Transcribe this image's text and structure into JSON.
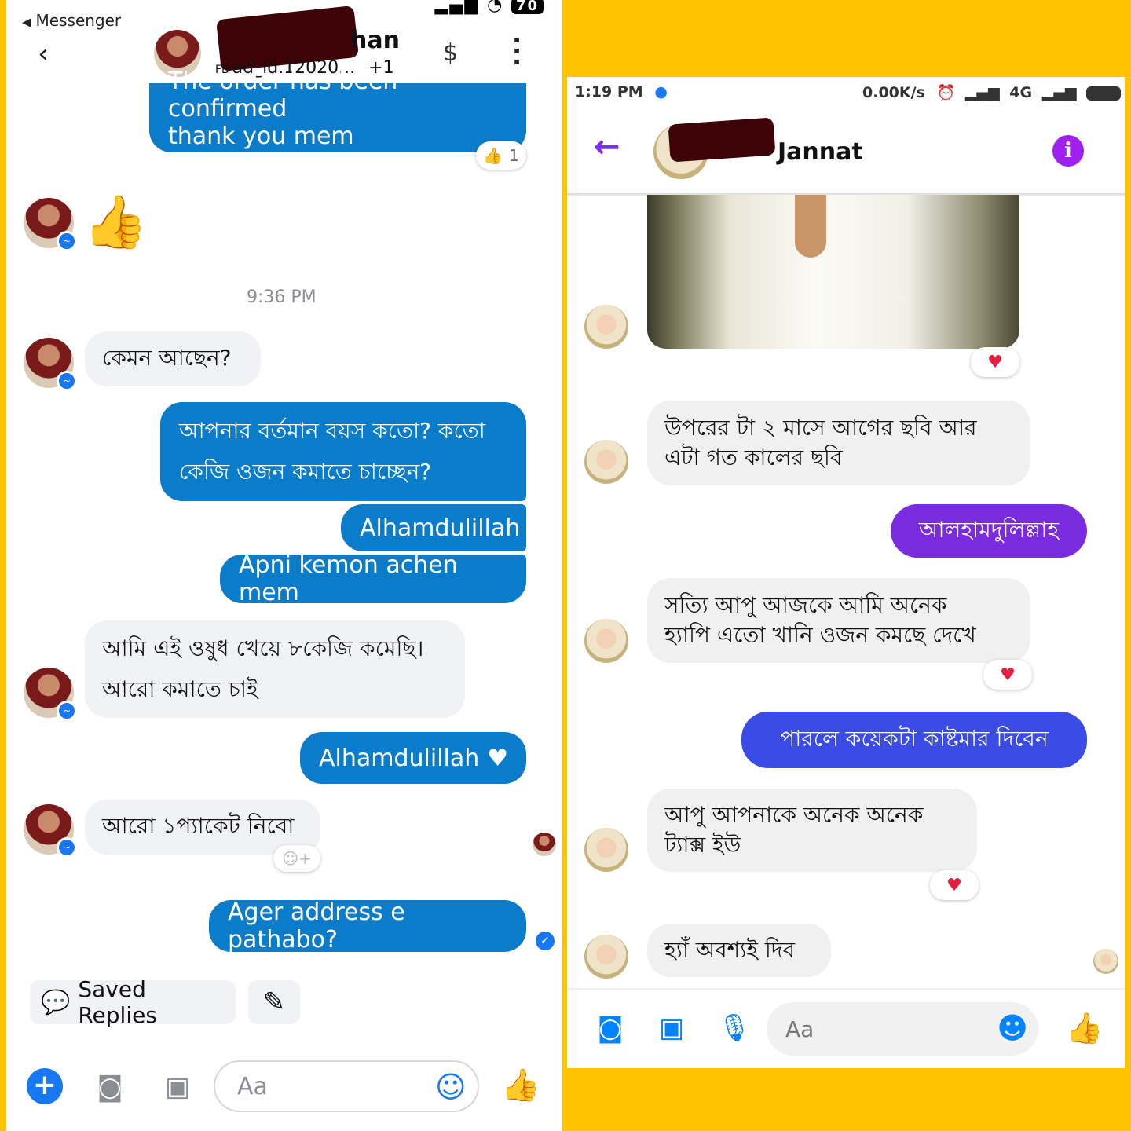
{
  "left": {
    "back_app": "Messenger",
    "battery": "70",
    "header": {
      "name_suffix": "han",
      "subtitle_tag": "FB",
      "subtitle": "ad_id.12020...",
      "subtitle_extra": "+1",
      "dollar": "$"
    },
    "messages": {
      "confirmed_top": "The order has been confirmed",
      "confirmed_bottom": "thank you mem",
      "reaction_count": "1",
      "time": "9:36 PM",
      "in1": "কেমন আছেন?",
      "out1_line1": "আপনার বর্তমান বয়স কতো? কতো",
      "out1_line2": "কেজি ওজন কমাতে চাচ্ছেন?",
      "out2": "Alhamdulillah",
      "out3": "Apni kemon achen mem",
      "in2_line1": "আমি এই ওষুধ খেয়ে ৮কেজি কমেছি।",
      "in2_line2": "আরো কমাতে চাই",
      "out4": "Alhamdulillah",
      "in3": "আরো ১প্যাকেট নিবো",
      "out5": "Ager address e pathabo?"
    },
    "saved_replies": "Saved Replies",
    "composer_placeholder": "Aa"
  },
  "right": {
    "status": {
      "time": "1:19 PM",
      "speed": "0.00K/s",
      "network": "4G"
    },
    "header": {
      "name_suffix": "Jannat"
    },
    "messages": {
      "in1_line1": "উপরের টা ২ মাসে আগের ছবি আর",
      "in1_line2": "এটা গত কালের ছবি",
      "out1": "আলহামদুলিল্লাহ",
      "in2_line1": "সত্যি আপু আজকে আমি অনেক",
      "in2_line2": "হ্যাপি এতো খানি ওজন কমছে দেখে",
      "out2": "পারলে কয়েকটা কাষ্টমার দিবেন",
      "in3_line1": "আপু আপনাকে অনেক অনেক",
      "in3_line2": "ট্যাক্স ইউ",
      "in4": "হ্যাঁ অবশ্যই দিব"
    },
    "composer_placeholder": "Aa"
  },
  "colors": {
    "page_bg": "#FFC300",
    "left_bubble": "#0A7CC9",
    "right_purple": "#7A2BE0",
    "right_blue": "#3B4BE6"
  },
  "icons": {
    "left_header": [
      "back-chevron",
      "dollar-sign",
      "more-vertical"
    ],
    "left_composer": [
      "plus",
      "camera",
      "image",
      "emoji",
      "thumbs-up"
    ],
    "right_composer": [
      "camera",
      "image",
      "microphone",
      "emoji",
      "thumbs-up"
    ]
  }
}
